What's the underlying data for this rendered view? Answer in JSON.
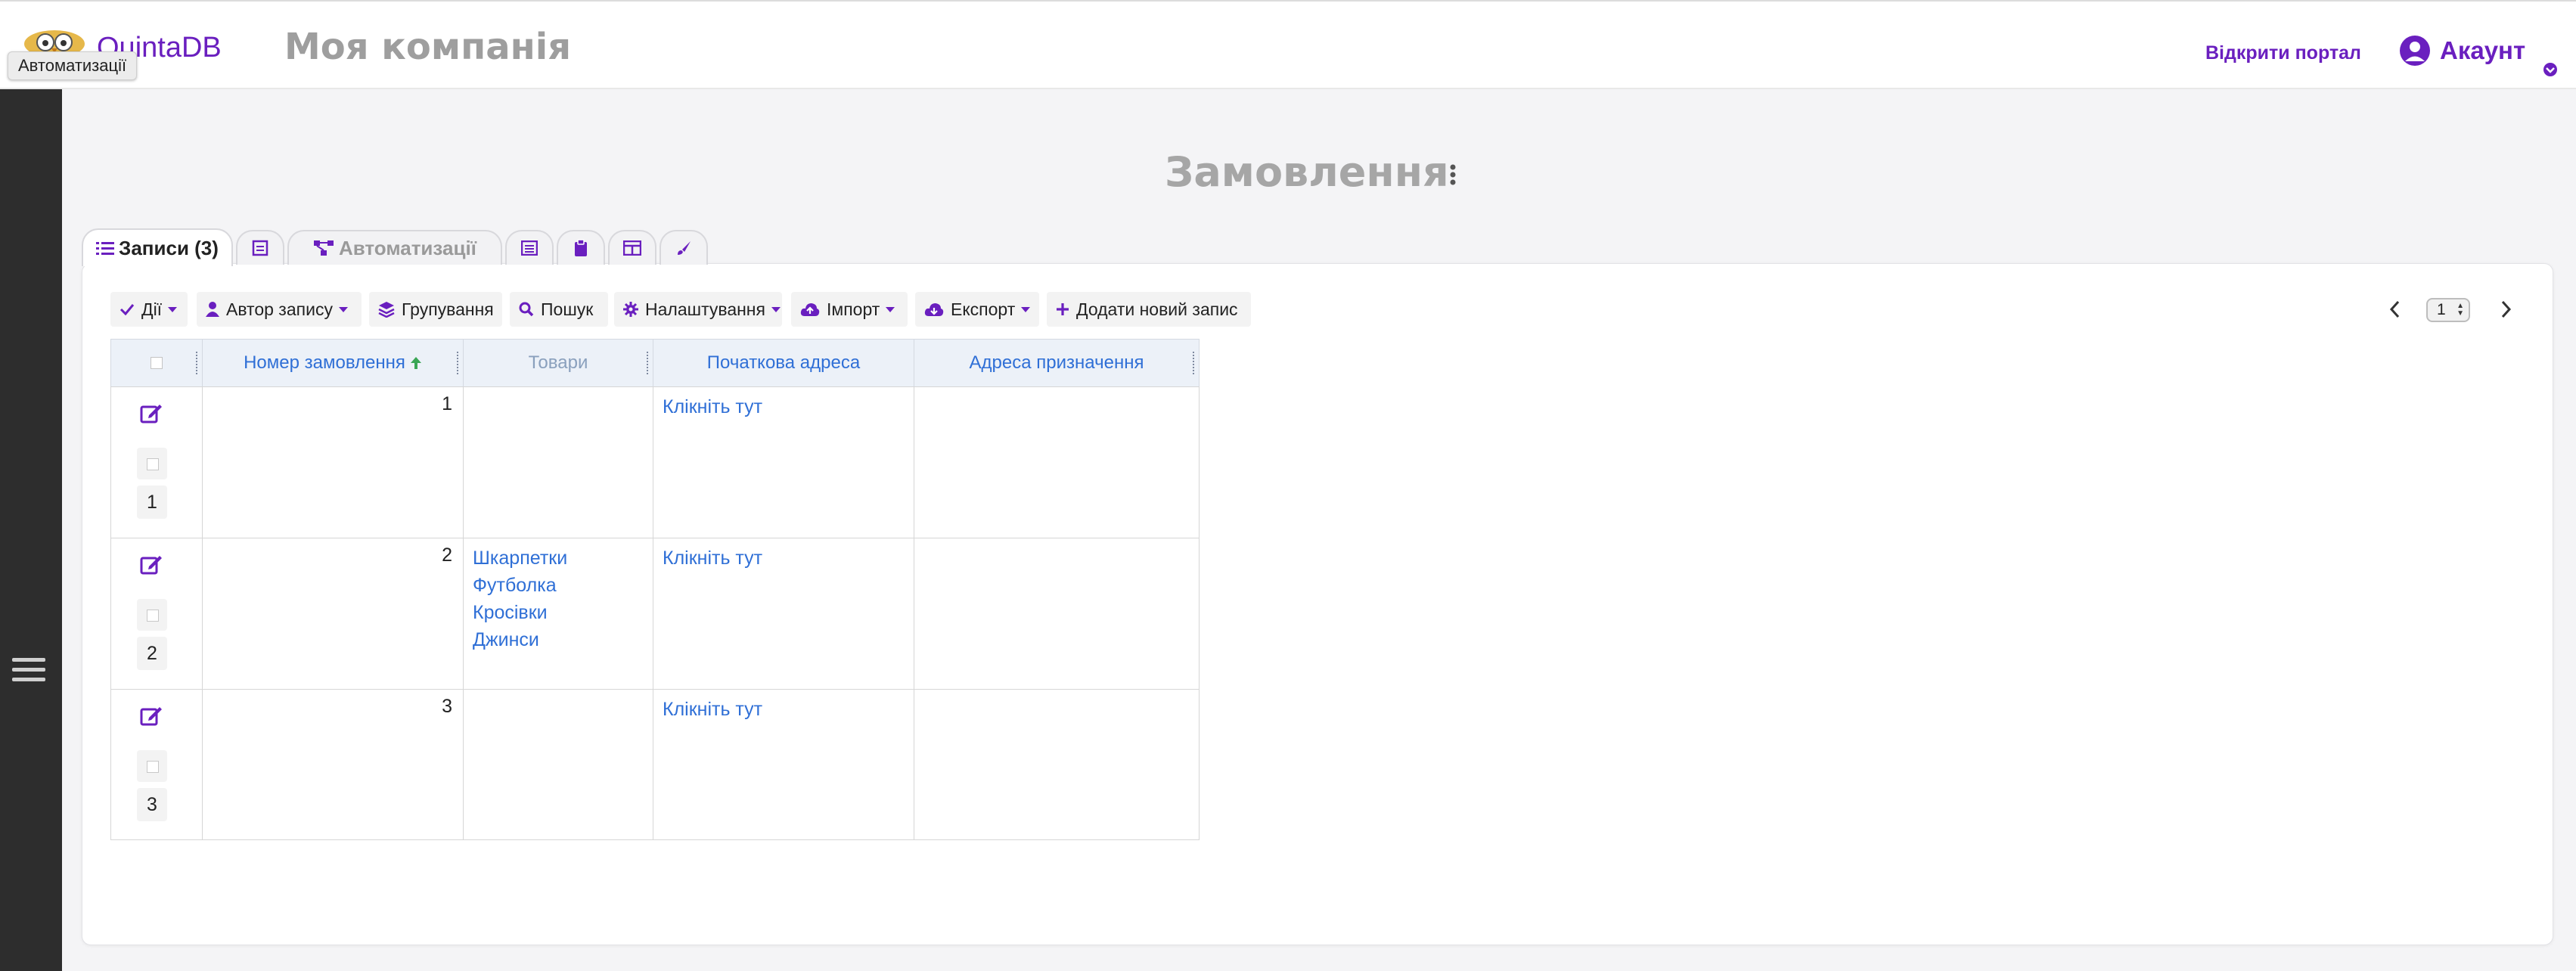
{
  "header": {
    "brand": "QuintaDB",
    "tooltip": "Автоматизації",
    "company": "Моя компанія",
    "portal_link": "Відкрити портал",
    "account": "Акаунт"
  },
  "page": {
    "title": "Замовлення"
  },
  "tabs": [
    {
      "label": "Записи (3)",
      "icon": "list-icon"
    },
    {
      "label": "",
      "icon": "form-icon"
    },
    {
      "label": "Автоматизації",
      "icon": "automation-icon"
    },
    {
      "label": "",
      "icon": "table-icon"
    },
    {
      "label": "",
      "icon": "clipboard-icon"
    },
    {
      "label": "",
      "icon": "layout-icon"
    },
    {
      "label": "",
      "icon": "brush-icon"
    }
  ],
  "toolbar": {
    "actions": "Дії",
    "author": "Автор запису",
    "grouping": "Групування",
    "search": "Пошук",
    "settings": "Налаштування",
    "import": "Імпорт",
    "export": "Експорт",
    "add": "Додати новий запис"
  },
  "pagination": {
    "page": "1"
  },
  "table": {
    "columns": [
      "Номер замовлення",
      "Товари",
      "Початкова адреса",
      "Адреса призначення"
    ],
    "rows": [
      {
        "index": "1",
        "order_no": "1",
        "items": [],
        "start": "Клікніть тут",
        "dest": ""
      },
      {
        "index": "2",
        "order_no": "2",
        "items": [
          "Шкарпетки",
          "Футболка",
          "Кросівки",
          "Джинси"
        ],
        "start": "Клікніть тут",
        "dest": ""
      },
      {
        "index": "3",
        "order_no": "3",
        "items": [],
        "start": "Клікніть тут",
        "dest": ""
      }
    ]
  },
  "colors": {
    "accent": "#6a1fbf",
    "link": "#2f6fd6",
    "sidebar": "#2d2d2d"
  }
}
